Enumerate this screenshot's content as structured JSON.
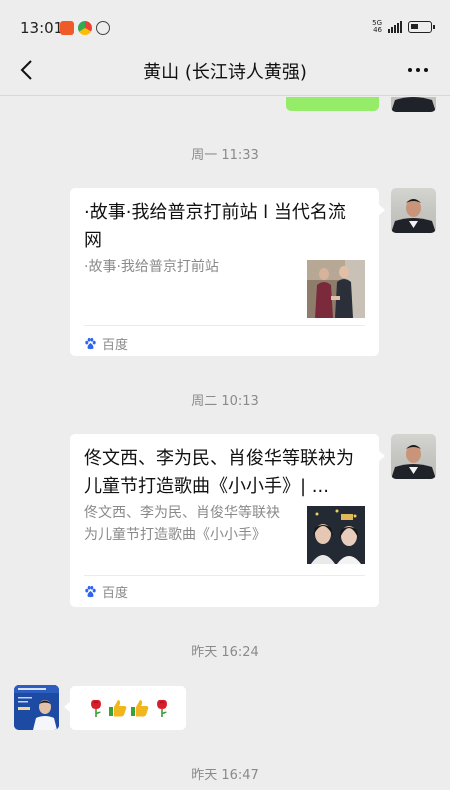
{
  "status_bar": {
    "time": "13:01",
    "network": "5G",
    "network_sub": "46",
    "battery_level": 0.4
  },
  "nav": {
    "title": "黄山 (长江诗人黄强)",
    "back_icon": "chevron-left-icon",
    "more_icon": "ellipsis-icon"
  },
  "messages": [
    {
      "type": "timestamp",
      "text": "周一 11:33"
    },
    {
      "type": "link_card",
      "side": "right",
      "title": "·故事·我给普京打前站 l 当代名流网",
      "description": "·故事·我给普京打前站",
      "source": "百度",
      "source_icon": "baidu-paw-icon"
    },
    {
      "type": "timestamp",
      "text": "周二 10:13"
    },
    {
      "type": "link_card",
      "side": "right",
      "title": "佟文西、李为民、肖俊华等联袂为儿童节打造歌曲《小小手》| ...",
      "description": "佟文西、李为民、肖俊华等联袂为儿童节打造歌曲《小小手》",
      "source": "百度",
      "source_icon": "baidu-paw-icon"
    },
    {
      "type": "timestamp",
      "text": "昨天 16:24"
    },
    {
      "type": "emoji_message",
      "side": "left",
      "emojis": [
        "rose-icon",
        "thumbs-up-icon",
        "thumbs-up-icon",
        "rose-icon"
      ]
    },
    {
      "type": "timestamp",
      "text": "昨天 16:47"
    }
  ],
  "colors": {
    "chat_background": "#ededed",
    "sent_bubble": "#95ec69",
    "card_background": "#ffffff",
    "meta_text": "#8a8a8a"
  }
}
